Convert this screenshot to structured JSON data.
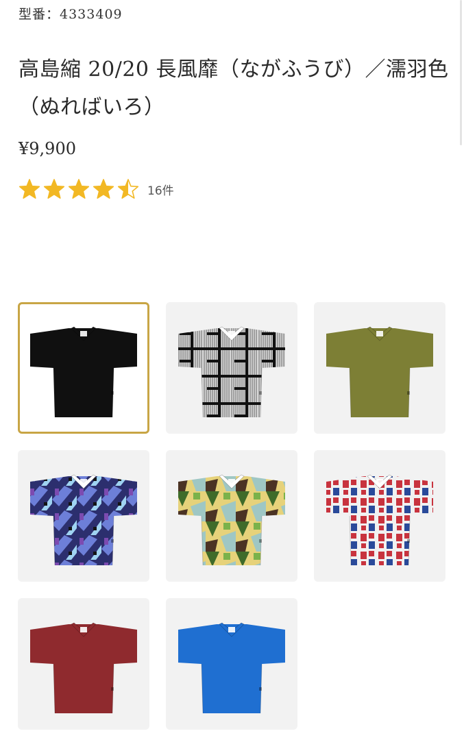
{
  "product": {
    "sku_label": "型番：4333409",
    "title": "高島縮 20/20 長風靡（ながふうび）／濡羽色（ぬればいろ）",
    "price": "¥9,900",
    "rating": {
      "value": 4.5,
      "max": 5,
      "count_label": "16件"
    }
  },
  "colors": {
    "star": "#f2b824",
    "selected_border": "#c8a545",
    "swatch_bg": "#f2f2f2"
  },
  "swatches": [
    {
      "name": "black",
      "color": "#101010",
      "pattern": "solid",
      "selected": true
    },
    {
      "name": "grey-lattice",
      "color": "#8a8a8a",
      "pattern": "lattice",
      "selected": false
    },
    {
      "name": "olive",
      "color": "#7d7f35",
      "pattern": "solid",
      "selected": false
    },
    {
      "name": "blue-purple-print",
      "color": "#3b4fa8",
      "pattern": "print-blue",
      "selected": false
    },
    {
      "name": "yellow-green-print",
      "color": "#d8c45a",
      "pattern": "print-yellow",
      "selected": false
    },
    {
      "name": "red-white-print",
      "color": "#c8333e",
      "pattern": "print-red",
      "selected": false
    },
    {
      "name": "crimson",
      "color": "#8f2a2e",
      "pattern": "solid",
      "selected": false
    },
    {
      "name": "blue",
      "color": "#1f6fd1",
      "pattern": "solid",
      "selected": false
    }
  ]
}
